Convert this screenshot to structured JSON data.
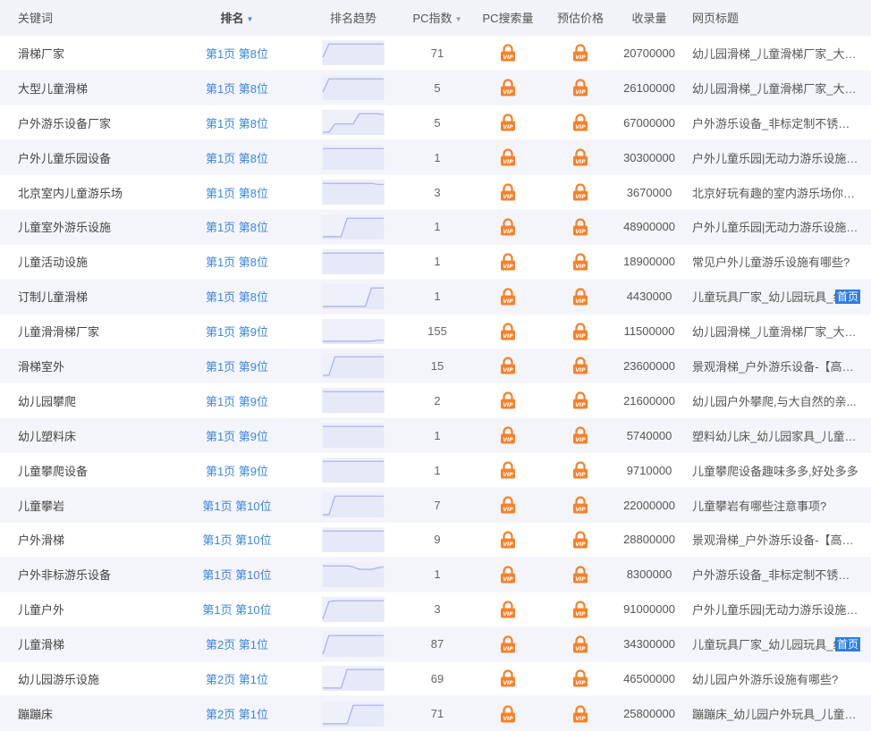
{
  "header": {
    "keyword": "关键词",
    "rank": "排名",
    "trend": "排名趋势",
    "pc_index": "PC指数",
    "pc_search": "PC搜索量",
    "price": "预估价格",
    "indexed": "收录量",
    "page_title": "网页标题"
  },
  "icons": {
    "sort": "sort-down-arrow-icon",
    "locked": "vip-lock-icon"
  },
  "colors": {
    "link": "#3b86e0",
    "lock": "#f5822a",
    "badge": "#2b7fe3",
    "trend_line": "#a8aee6",
    "trend_fill": "#eef0fa"
  },
  "rows": [
    {
      "keyword": "滑梯厂家",
      "rank": "第1页 第8位",
      "pc_index": "71",
      "indexed": "20700000",
      "title": "幼儿园滑梯_儿童滑梯厂家_大型...",
      "badge": "",
      "trend": [
        0.3,
        0.95,
        0.95,
        0.95,
        0.95,
        0.95,
        0.95,
        0.95,
        0.95,
        0.95,
        0.95
      ]
    },
    {
      "keyword": "大型儿童滑梯",
      "rank": "第1页 第8位",
      "pc_index": "5",
      "indexed": "26100000",
      "title": "幼儿园滑梯_儿童滑梯厂家_大型...",
      "badge": "",
      "trend": [
        0.3,
        0.95,
        0.95,
        0.95,
        0.95,
        0.95,
        0.95,
        0.95,
        0.95,
        0.95,
        0.95
      ]
    },
    {
      "keyword": "户外游乐设备厂家",
      "rank": "第1页 第8位",
      "pc_index": "5",
      "indexed": "67000000",
      "title": "户外游乐设备_非标定制不锈钢...",
      "badge": "",
      "trend": [
        0.05,
        0.05,
        0.45,
        0.45,
        0.45,
        0.45,
        0.95,
        0.95,
        0.95,
        0.95,
        0.9
      ]
    },
    {
      "keyword": "户外儿童乐园设备",
      "rank": "第1页 第8位",
      "pc_index": "1",
      "indexed": "30300000",
      "title": "户外儿童乐园|无动力游乐设施|...",
      "badge": "",
      "trend": [
        0.95,
        0.95,
        0.95,
        0.95,
        0.95,
        0.95,
        0.95,
        0.95,
        0.95,
        0.95,
        0.95
      ]
    },
    {
      "keyword": "北京室内儿童游乐场",
      "rank": "第1页 第8位",
      "pc_index": "3",
      "indexed": "3670000",
      "title": "北京好玩有趣的室内游乐场你家...",
      "badge": "",
      "trend": [
        0.95,
        0.95,
        0.95,
        0.95,
        0.95,
        0.95,
        0.95,
        0.95,
        0.95,
        0.9,
        0.9
      ]
    },
    {
      "keyword": "儿童室外游乐设施",
      "rank": "第1页 第8位",
      "pc_index": "1",
      "indexed": "48900000",
      "title": "户外儿童乐园|无动力游乐设施|...",
      "badge": "",
      "trend": [
        0.05,
        0.05,
        0.05,
        0.05,
        0.95,
        0.95,
        0.95,
        0.95,
        0.95,
        0.95,
        0.95
      ]
    },
    {
      "keyword": "儿童活动设施",
      "rank": "第1页 第8位",
      "pc_index": "1",
      "indexed": "18900000",
      "title": "常见户外儿童游乐设施有哪些?",
      "badge": "",
      "trend": [
        0.95,
        0.95,
        0.95,
        0.95,
        0.95,
        0.95,
        0.95,
        0.95,
        0.95,
        0.95,
        0.95
      ]
    },
    {
      "keyword": "订制儿童滑梯",
      "rank": "第1页 第8位",
      "pc_index": "1",
      "indexed": "4430000",
      "title": "儿童玩具厂家_幼儿园玩具_组",
      "badge": "首页",
      "trend": [
        0.05,
        0.05,
        0.05,
        0.05,
        0.05,
        0.05,
        0.05,
        0.05,
        0.95,
        0.95,
        0.95
      ]
    },
    {
      "keyword": "儿童滑滑梯厂家",
      "rank": "第1页 第9位",
      "pc_index": "155",
      "indexed": "11500000",
      "title": "幼儿园滑梯_儿童滑梯厂家_大型...",
      "badge": "",
      "trend": [
        0.05,
        0.05,
        0.05,
        0.05,
        0.05,
        0.05,
        0.05,
        0.05,
        0.05,
        0.1,
        0.1
      ]
    },
    {
      "keyword": "滑梯室外",
      "rank": "第1页 第9位",
      "pc_index": "15",
      "indexed": "23600000",
      "title": "景观滑梯_户外游乐设备-【高乐...",
      "badge": "",
      "trend": [
        0.05,
        0.05,
        0.95,
        0.95,
        0.95,
        0.95,
        0.95,
        0.95,
        0.95,
        0.95,
        0.95
      ]
    },
    {
      "keyword": "幼儿园攀爬",
      "rank": "第1页 第9位",
      "pc_index": "2",
      "indexed": "21600000",
      "title": "幼儿园户外攀爬,与大自然的亲...",
      "badge": "",
      "trend": [
        0.95,
        0.95,
        0.95,
        0.95,
        0.95,
        0.95,
        0.95,
        0.95,
        0.95,
        0.95,
        0.95
      ]
    },
    {
      "keyword": "幼儿塑料床",
      "rank": "第1页 第9位",
      "pc_index": "1",
      "indexed": "5740000",
      "title": "塑料幼儿床_幼儿园家具_儿童床...",
      "badge": "",
      "trend": [
        0.95,
        0.95,
        0.95,
        0.95,
        0.95,
        0.95,
        0.95,
        0.95,
        0.95,
        0.95,
        0.95
      ]
    },
    {
      "keyword": "儿童攀爬设备",
      "rank": "第1页 第9位",
      "pc_index": "1",
      "indexed": "9710000",
      "title": "儿童攀爬设备趣味多多,好处多多",
      "badge": "",
      "trend": [
        0.95,
        0.95,
        0.95,
        0.95,
        0.95,
        0.95,
        0.95,
        0.95,
        0.95,
        0.95,
        0.95
      ]
    },
    {
      "keyword": "儿童攀岩",
      "rank": "第1页 第10位",
      "pc_index": "7",
      "indexed": "22000000",
      "title": "儿童攀岩有哪些注意事项?",
      "badge": "",
      "trend": [
        0.05,
        0.05,
        0.95,
        0.95,
        0.95,
        0.95,
        0.95,
        0.95,
        0.95,
        0.95,
        0.95
      ]
    },
    {
      "keyword": "户外滑梯",
      "rank": "第1页 第10位",
      "pc_index": "9",
      "indexed": "28800000",
      "title": "景观滑梯_户外游乐设备-【高乐...",
      "badge": "",
      "trend": [
        0.95,
        0.95,
        0.95,
        0.95,
        0.95,
        0.95,
        0.95,
        0.95,
        0.95,
        0.95,
        0.95
      ]
    },
    {
      "keyword": "户外非标游乐设备",
      "rank": "第1页 第10位",
      "pc_index": "1",
      "indexed": "8300000",
      "title": "户外游乐设备_非标定制不锈钢...",
      "badge": "",
      "trend": [
        0.95,
        0.95,
        0.95,
        0.95,
        0.95,
        0.9,
        0.78,
        0.78,
        0.78,
        0.85,
        0.9
      ]
    },
    {
      "keyword": "儿童户外",
      "rank": "第1页 第10位",
      "pc_index": "3",
      "indexed": "91000000",
      "title": "户外儿童乐园|无动力游乐设施|...",
      "badge": "",
      "trend": [
        0.05,
        0.9,
        0.95,
        0.95,
        0.95,
        0.95,
        0.95,
        0.95,
        0.95,
        0.95,
        0.95
      ]
    },
    {
      "keyword": "儿童滑梯",
      "rank": "第2页 第1位",
      "pc_index": "87",
      "indexed": "34300000",
      "title": "儿童玩具厂家_幼儿园玩具_组",
      "badge": "首页",
      "trend": [
        0.05,
        0.95,
        0.95,
        0.95,
        0.95,
        0.95,
        0.95,
        0.95,
        0.95,
        0.95,
        0.95
      ]
    },
    {
      "keyword": "幼儿园游乐设施",
      "rank": "第2页 第1位",
      "pc_index": "69",
      "indexed": "46500000",
      "title": "幼儿园户外游乐设施有哪些?",
      "badge": "",
      "trend": [
        0.05,
        0.05,
        0.05,
        0.05,
        0.95,
        0.95,
        0.95,
        0.95,
        0.95,
        0.95,
        0.95
      ]
    },
    {
      "keyword": "蹦蹦床",
      "rank": "第2页 第1位",
      "pc_index": "71",
      "indexed": "25800000",
      "title": "蹦蹦床_幼儿园户外玩具_儿童户...",
      "badge": "",
      "trend": [
        0.05,
        0.05,
        0.05,
        0.05,
        0.05,
        0.95,
        0.95,
        0.95,
        0.95,
        0.95,
        0.95
      ]
    }
  ]
}
